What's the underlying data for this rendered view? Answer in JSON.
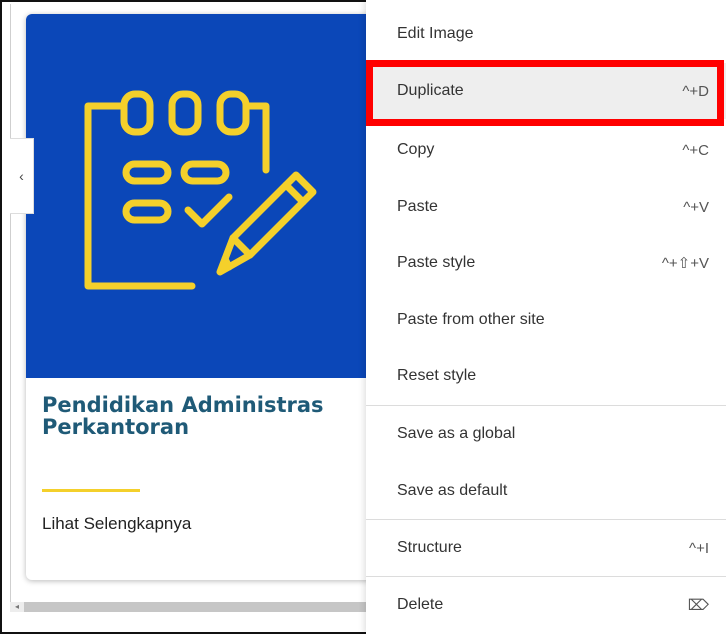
{
  "card": {
    "title_line1": "Pendidikan Administras",
    "title_line2": "Perkantoran",
    "link_label": "Lihat Selengkapnya",
    "image_icon": "checklist-pencil-icon"
  },
  "sidebar_toggle": {
    "glyph": "‹",
    "icon": "chevron-left-icon"
  },
  "context_menu": {
    "items": [
      {
        "label": "Edit Image",
        "shortcut": ""
      },
      {
        "label": "Duplicate",
        "shortcut": "^+D"
      },
      {
        "label": "Copy",
        "shortcut": "^+C"
      },
      {
        "label": "Paste",
        "shortcut": "^+V"
      },
      {
        "label": "Paste style",
        "shortcut": "^+⇧+V"
      },
      {
        "label": "Paste from other site",
        "shortcut": ""
      },
      {
        "label": "Reset style",
        "shortcut": ""
      },
      {
        "label": "Save as a global",
        "shortcut": ""
      },
      {
        "label": "Save as default",
        "shortcut": ""
      },
      {
        "label": "Structure",
        "shortcut": "^+I"
      },
      {
        "label": "Delete",
        "shortcut": "⌦",
        "shortcut_icon": "delete-key-icon"
      }
    ],
    "highlighted": "Duplicate"
  },
  "colors": {
    "image_background": "#0b47b8",
    "icon_yellow": "#f4d02b",
    "title": "#1f5a77",
    "highlight_box": "#ff0000"
  }
}
